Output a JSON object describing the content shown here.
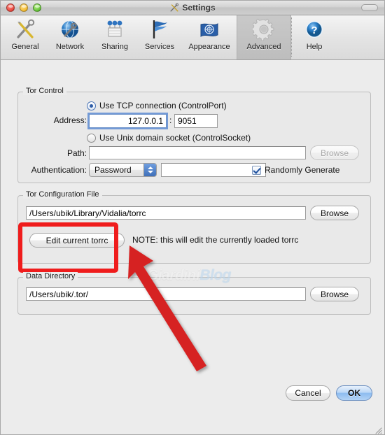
{
  "window": {
    "title": "Settings",
    "title_icon": "tools-icon",
    "traffic_lights": [
      "close-button",
      "minimize-button",
      "zoom-button"
    ],
    "toolbar_toggle": "toolbar-toggle-button"
  },
  "toolbar": {
    "items": [
      {
        "label": "General",
        "icon": "tools-icon",
        "selected": false
      },
      {
        "label": "Network",
        "icon": "globe-wrench-icon",
        "selected": false
      },
      {
        "label": "Sharing",
        "icon": "sharing-dots-icon",
        "selected": false
      },
      {
        "label": "Services",
        "icon": "flag-icon",
        "selected": false
      },
      {
        "label": "Appearance",
        "icon": "un-flag-icon",
        "selected": false
      },
      {
        "label": "Advanced",
        "icon": "gear-icon",
        "selected": true
      },
      {
        "label": "Help",
        "icon": "help-circle-icon",
        "selected": false
      }
    ]
  },
  "tor_control": {
    "group_title": "Tor Control",
    "tcp_radio_label": "Use TCP connection (ControlPort)",
    "tcp_radio_selected": true,
    "address_label": "Address:",
    "address_value": "127.0.0.1",
    "address_separator": ":",
    "port_value": "9051",
    "socket_radio_label": "Use Unix domain socket (ControlSocket)",
    "socket_radio_selected": false,
    "path_label": "Path:",
    "path_value": "",
    "path_browse_label": "Browse",
    "path_browse_disabled": true,
    "auth_label": "Authentication:",
    "auth_value": "Password",
    "auth_options": [
      "Password"
    ],
    "auth_password_value": "",
    "random_generate_label": "Randomly Generate",
    "random_generate_checked": true
  },
  "tor_config_file": {
    "group_title": "Tor Configuration File",
    "path_value": "/Users/ubik/Library/Vidalia/torrc",
    "browse_label": "Browse",
    "edit_button_label": "Edit current torrc",
    "note_text": "NOTE: this will edit the currently loaded torrc"
  },
  "data_directory": {
    "group_title": "Data Directory",
    "path_value": "/Users/ubik/.tor/",
    "browse_label": "Browse"
  },
  "footer": {
    "cancel_label": "Cancel",
    "ok_label": "OK"
  },
  "watermark": {
    "part_a": "Giardini",
    "part_b": "Blog"
  },
  "annotations": {
    "highlight_color": "#ef1c1c",
    "highlight_target": "edit-current-torrc-button",
    "arrow_color": "#d62020"
  }
}
